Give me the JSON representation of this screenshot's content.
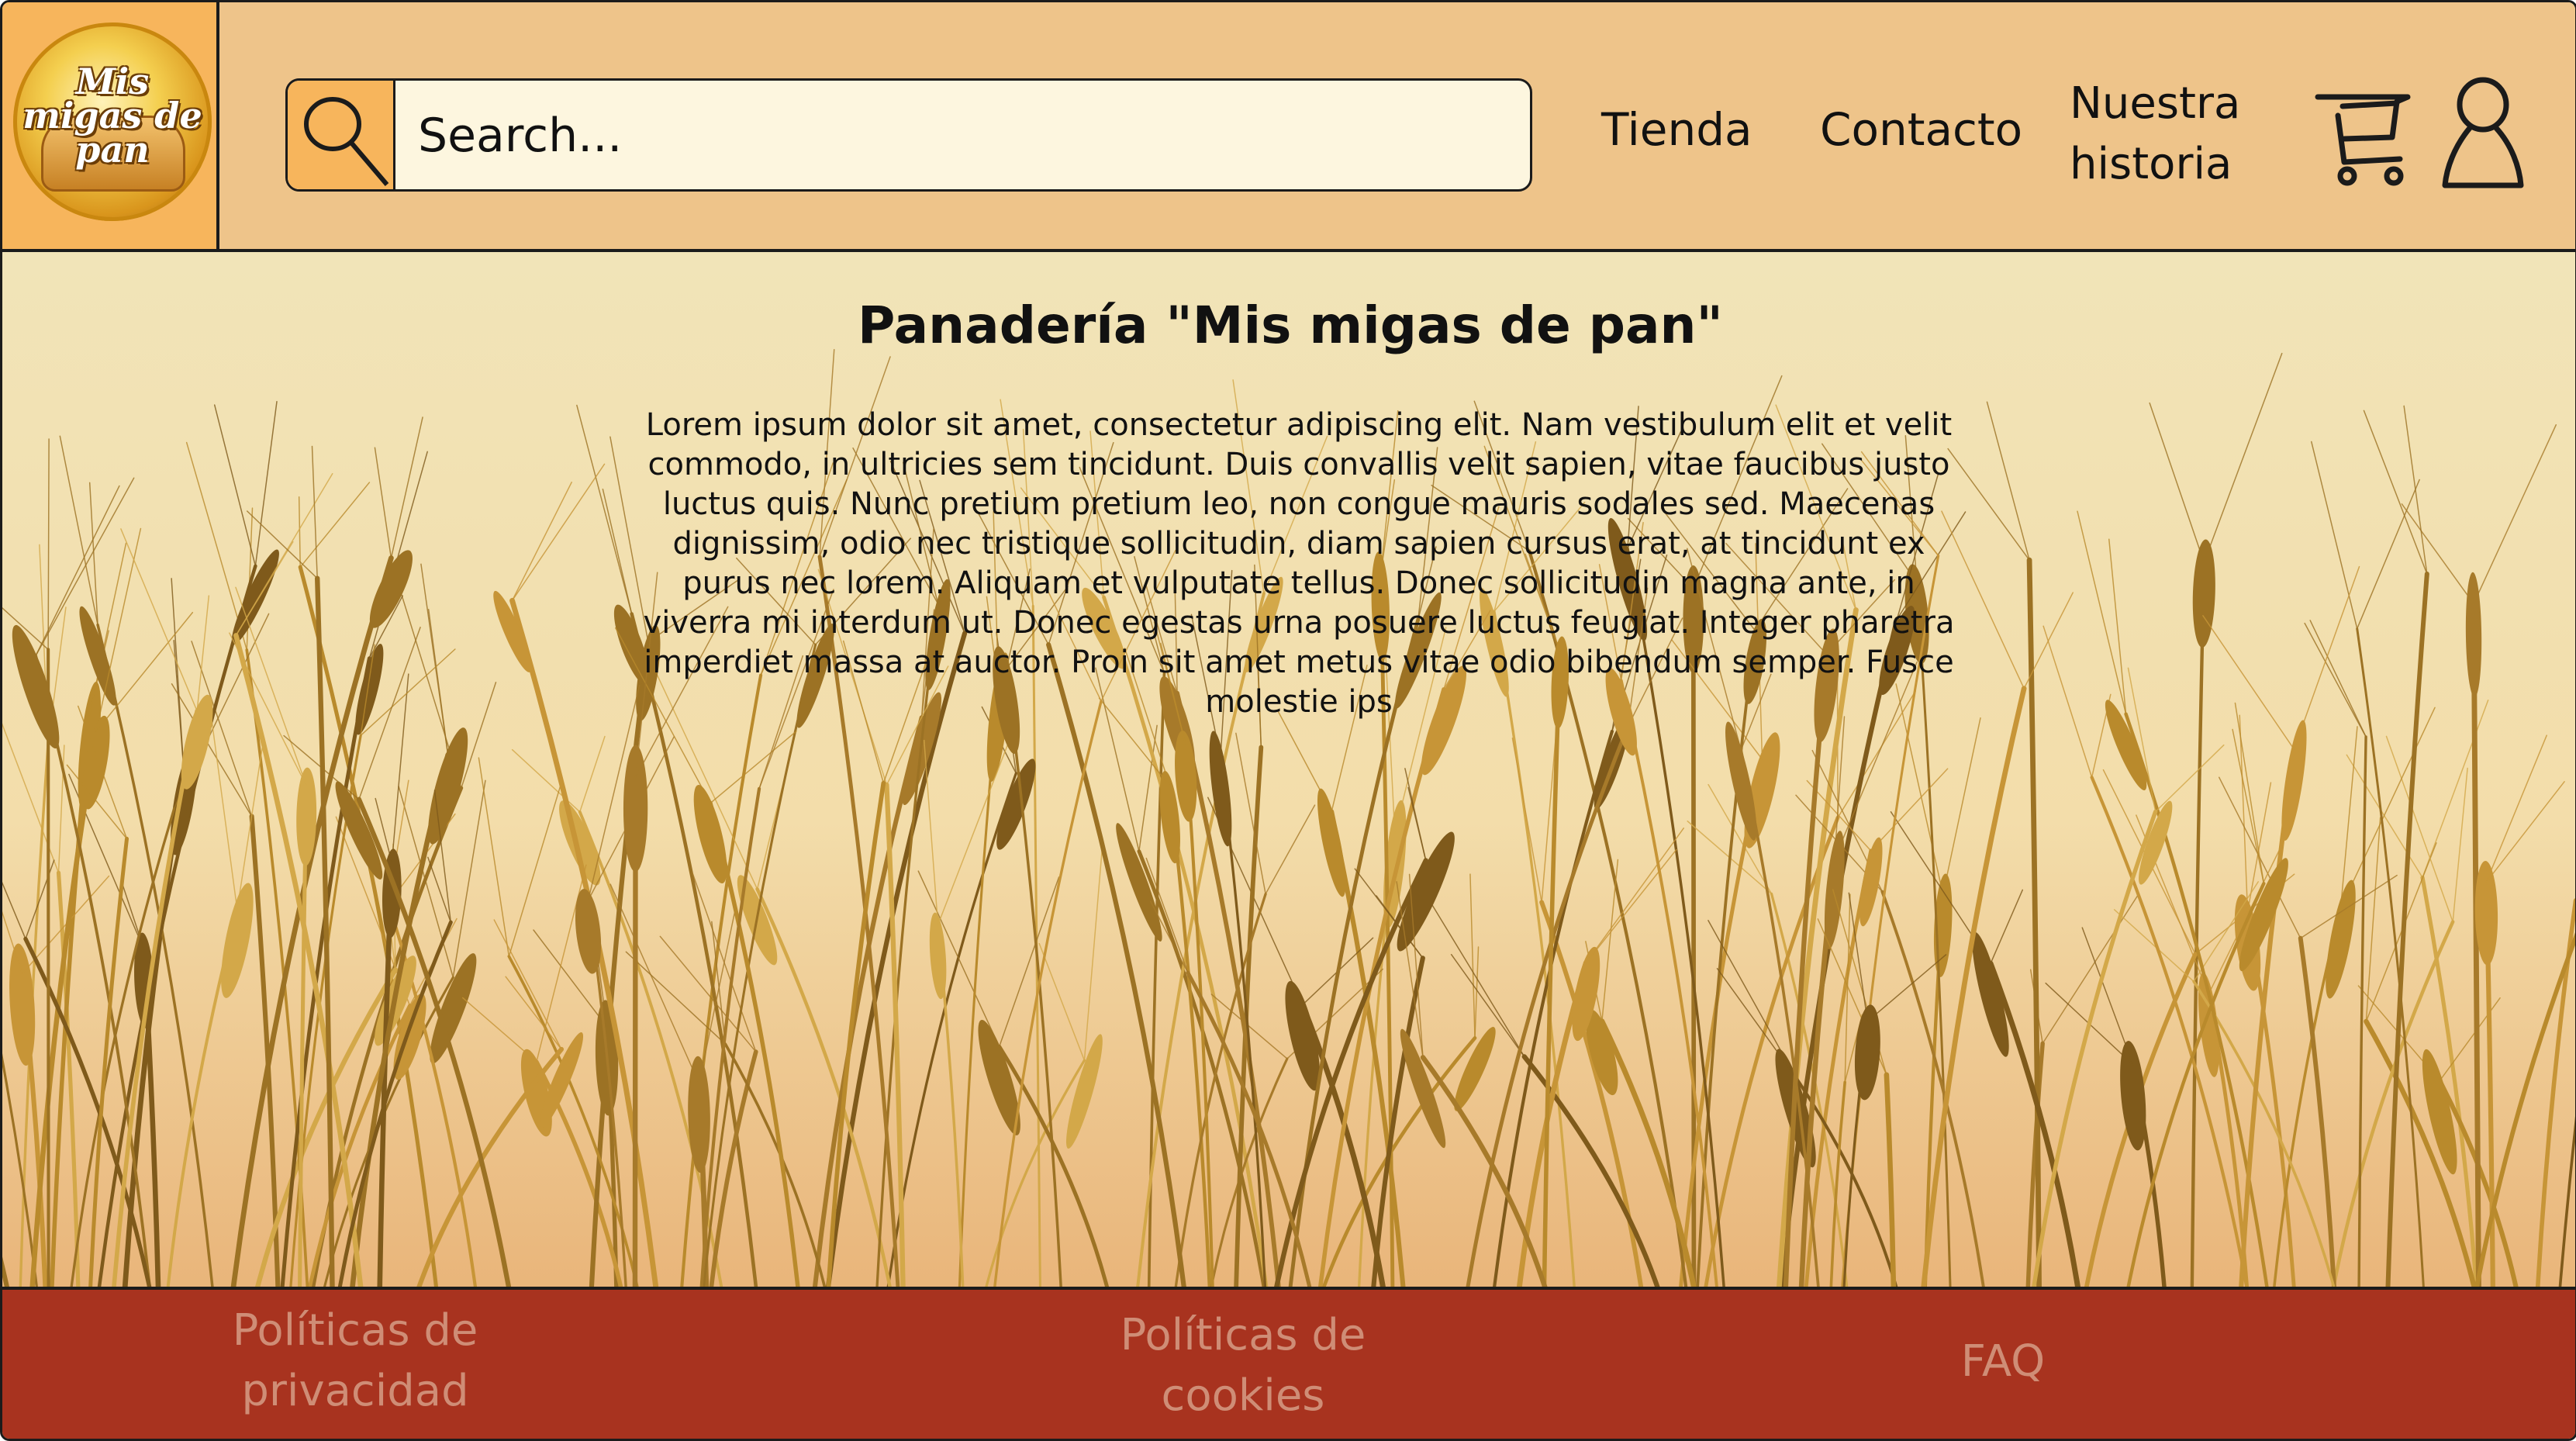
{
  "header": {
    "logo_text": "Mis migas de pan",
    "search": {
      "placeholder": "Search...",
      "value": ""
    },
    "nav": {
      "tienda": "Tienda",
      "contacto": "Contacto",
      "nuestra_historia": "Nuestra historia"
    },
    "icons": {
      "search": "search-icon",
      "cart": "cart-icon",
      "user": "user-icon"
    }
  },
  "main": {
    "title": "Panadería \"Mis migas de pan\"",
    "body": "Lorem ipsum dolor sit amet, consectetur adipiscing elit. Nam vestibulum elit et velit commodo, in ultricies sem tincidunt. Duis convallis velit sapien, vitae faucibus justo luctus quis. Nunc pretium pretium leo, non congue mauris sodales sed. Maecenas dignissim, odio nec tristique sollicitudin, diam sapien cursus erat, at tincidunt ex purus nec lorem. Aliquam et vulputate tellus. Donec sollicitudin magna ante, in viverra mi interdum ut. Donec egestas urna posuere luctus feugiat. Integer pharetra imperdiet massa at auctor. Proin sit amet metus vitae odio bibendum semper. Fusce molestie ips"
  },
  "footer": {
    "privacidad": "Políticas de privacidad",
    "cookies": "Políticas de cookies",
    "faq": "FAQ"
  },
  "colors": {
    "header_bg": "#eec48a",
    "accent_orange": "#f7b55c",
    "page_bg": "#f1e4b8",
    "footer_bg": "#a8331f",
    "footer_link": "#cf8d76"
  }
}
